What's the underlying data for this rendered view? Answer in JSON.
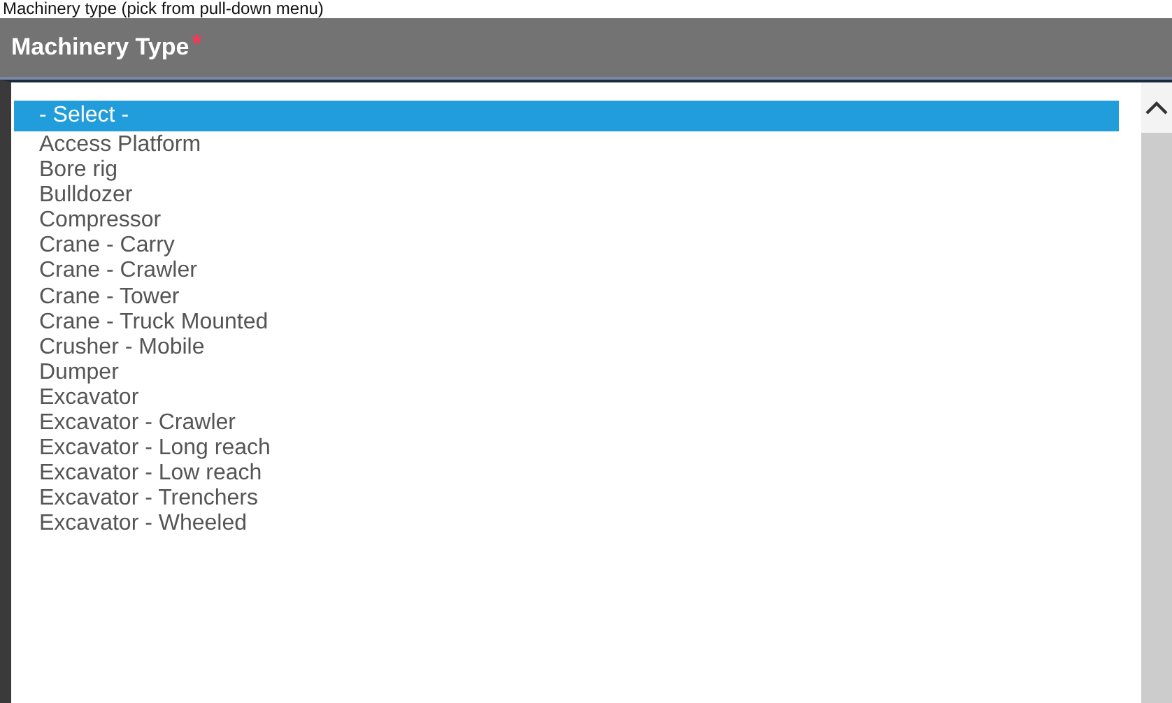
{
  "caption": "Machinery type (pick from pull-down menu)",
  "field": {
    "label": "Machinery Type",
    "required_mark": "*"
  },
  "options": [
    {
      "label": "- Select -",
      "selected": true
    },
    {
      "label": "Access Platform",
      "selected": false
    },
    {
      "label": "Bore rig",
      "selected": false
    },
    {
      "label": "Bulldozer",
      "selected": false
    },
    {
      "label": "Compressor",
      "selected": false
    },
    {
      "label": "Crane - Carry",
      "selected": false
    },
    {
      "label": "Crane - Crawler",
      "selected": false
    },
    {
      "label": "Crane - Tower",
      "selected": false
    },
    {
      "label": "Crane - Truck Mounted",
      "selected": false
    },
    {
      "label": "Crusher - Mobile",
      "selected": false
    },
    {
      "label": "Dumper",
      "selected": false
    },
    {
      "label": "Excavator",
      "selected": false
    },
    {
      "label": "Excavator - Crawler",
      "selected": false
    },
    {
      "label": "Excavator - Long reach",
      "selected": false
    },
    {
      "label": "Excavator - Low reach",
      "selected": false
    },
    {
      "label": "Excavator - Trenchers",
      "selected": false
    },
    {
      "label": "Excavator - Wheeled",
      "selected": false
    }
  ]
}
